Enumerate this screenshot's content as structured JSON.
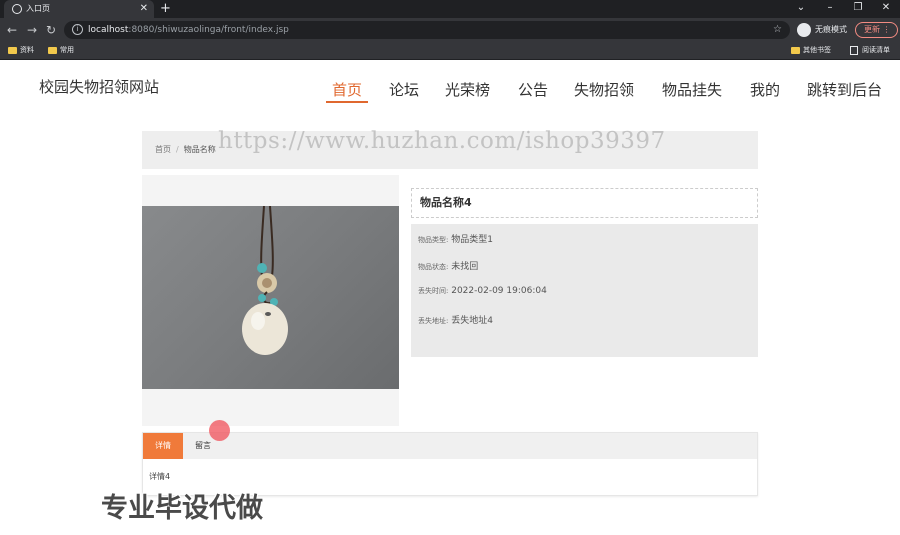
{
  "browser": {
    "tab_title": "入口页",
    "url_host": "localhost",
    "url_rest": ":8080/shiwuzaolinga/front/index.jsp",
    "incognito_label": "无痕模式",
    "update_label": "更新",
    "bookmarks": [
      "资料",
      "常用"
    ],
    "bookmarks_right": [
      "其他书签",
      "阅读清单"
    ]
  },
  "site": {
    "title": "校园失物招领网站",
    "nav": [
      "首页",
      "论坛",
      "光荣榜",
      "公告",
      "失物招领",
      "物品挂失",
      "我的",
      "跳转到后台"
    ]
  },
  "breadcrumb": {
    "home": "首页",
    "sep": "/",
    "current": "物品名称"
  },
  "item": {
    "name": "物品名称4",
    "fields": [
      {
        "label": "物品类型:",
        "value": "物品类型1"
      },
      {
        "label": "物品状态:",
        "value": "未找回"
      },
      {
        "label": "丢失时间:",
        "value": "2022-02-09 19:06:04"
      },
      {
        "label": "丢失地址:",
        "value": "丢失地址4"
      }
    ]
  },
  "tabs": {
    "detail_label": "详情",
    "comment_label": "留言",
    "detail_text": "详情4"
  },
  "overlay": {
    "watermark": "https://www.huzhan.com/ishop39397",
    "promo": "专业毕设代做"
  }
}
